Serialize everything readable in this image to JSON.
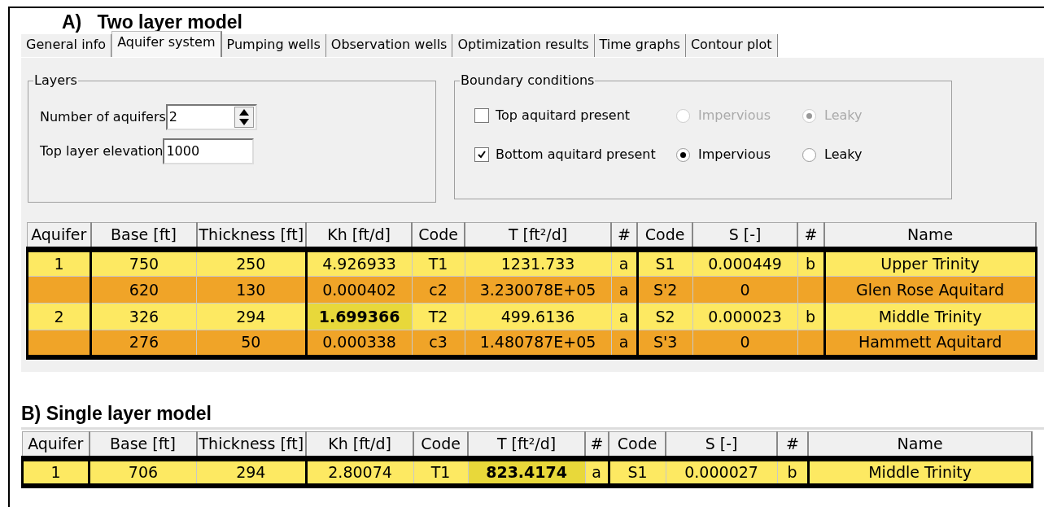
{
  "section_a": {
    "heading": "A)   Two layer model",
    "tabs": [
      {
        "label": "General info",
        "selected": false
      },
      {
        "label": "Aquifer system",
        "selected": true
      },
      {
        "label": "Pumping wells",
        "selected": false
      },
      {
        "label": "Observation wells",
        "selected": false
      },
      {
        "label": "Optimization results",
        "selected": false
      },
      {
        "label": "Time graphs",
        "selected": false
      },
      {
        "label": "Contour plot",
        "selected": false
      }
    ],
    "layers": {
      "title": "Layers",
      "fields": [
        {
          "label": "Number of aquifers",
          "value": "2",
          "kind": "spinner"
        },
        {
          "label": "Top layer elevation",
          "value": "1000",
          "kind": "text"
        }
      ]
    },
    "boundary": {
      "title": "Boundary conditions",
      "rows": [
        {
          "label": "Top aquitard present",
          "checked": false,
          "options": [
            {
              "label": "Impervious",
              "selected": false,
              "disabled": true
            },
            {
              "label": "Leaky",
              "selected": true,
              "disabled": true
            }
          ]
        },
        {
          "label": "Bottom aquitard present",
          "checked": true,
          "options": [
            {
              "label": "Impervious",
              "selected": true,
              "disabled": false
            },
            {
              "label": "Leaky",
              "selected": false,
              "disabled": false
            }
          ]
        }
      ]
    },
    "table": {
      "columns": [
        "Aquifer",
        "Base [ft]",
        "Thickness [ft]",
        "Kh [ft/d]",
        "Code",
        "T [ft²/d]",
        "#",
        "Code",
        "S [-]",
        "#",
        "Name"
      ],
      "rows": [
        {
          "kind": "aquifer",
          "bold": [
            false,
            false,
            false,
            false,
            false,
            false,
            false,
            false,
            false,
            false,
            false
          ],
          "cells": [
            "1",
            "750",
            "250",
            "4.926933",
            "T1",
            "1231.733",
            "a",
            "S1",
            "0.000449",
            "b",
            "Upper Trinity"
          ]
        },
        {
          "kind": "aquitard",
          "bold": [
            false,
            false,
            false,
            false,
            false,
            false,
            false,
            false,
            false,
            false,
            false
          ],
          "cells": [
            null,
            "620",
            "130",
            "0.000402",
            "c2",
            "3.230078E+05",
            "a",
            "S'2",
            "0",
            null,
            "Glen Rose Aquitard"
          ]
        },
        {
          "kind": "aquifer",
          "bold": [
            false,
            false,
            false,
            true,
            false,
            false,
            false,
            false,
            false,
            false,
            false
          ],
          "cells": [
            "2",
            "326",
            "294",
            "1.699366",
            "T2",
            "499.6136",
            "a",
            "S2",
            "0.000023",
            "b",
            "Middle Trinity"
          ]
        },
        {
          "kind": "aquitard",
          "bold": [
            false,
            false,
            false,
            false,
            false,
            false,
            false,
            false,
            false,
            false,
            false
          ],
          "cells": [
            null,
            "276",
            "50",
            "0.000338",
            "c3",
            "1.480787E+05",
            "a",
            "S'3",
            "0",
            null,
            "Hammett Aquitard"
          ]
        }
      ]
    }
  },
  "section_b": {
    "heading": "B) Single layer model",
    "table": {
      "columns": [
        "Aquifer",
        "Base [ft]",
        "Thickness [ft]",
        "Kh [ft/d]",
        "Code",
        "T [ft²/d]",
        "#",
        "Code",
        "S [-]",
        "#",
        "Name"
      ],
      "rows": [
        {
          "kind": "aquifer",
          "bold": [
            false,
            false,
            false,
            false,
            false,
            true,
            false,
            false,
            false,
            false,
            false
          ],
          "cells": [
            "1",
            "706",
            "294",
            "2.80074",
            "T1",
            "823.4174",
            "a",
            "S1",
            "0.000027",
            "b",
            "Middle Trinity"
          ]
        }
      ]
    }
  }
}
